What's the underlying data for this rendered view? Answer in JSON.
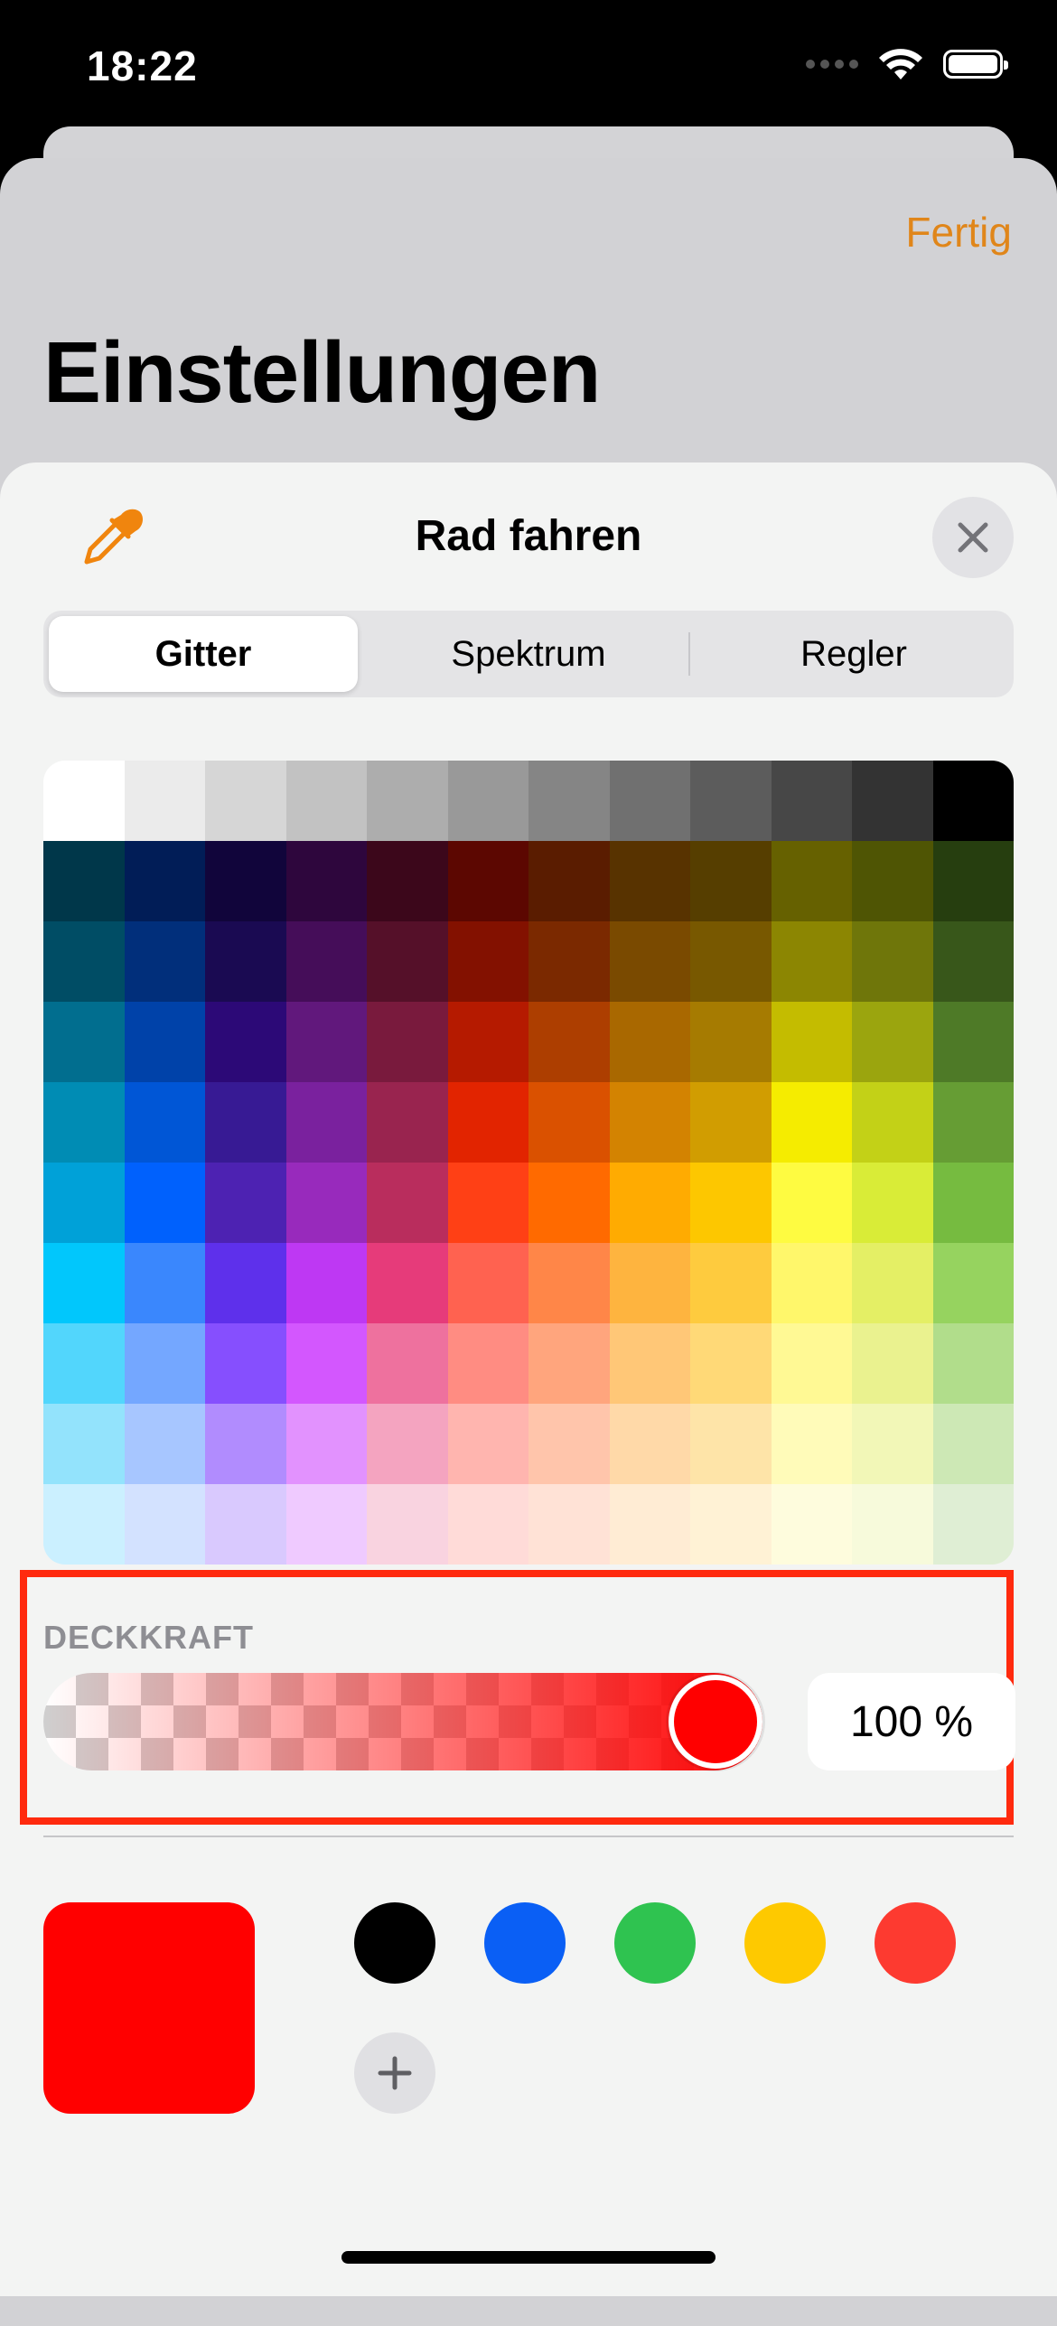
{
  "status_bar": {
    "time": "18:22"
  },
  "settings": {
    "done_label": "Fertig",
    "title": "Einstellungen"
  },
  "picker": {
    "title": "Rad fahren",
    "tabs": [
      {
        "label": "Gitter",
        "active": true
      },
      {
        "label": "Spektrum",
        "active": false
      },
      {
        "label": "Regler",
        "active": false
      }
    ],
    "opacity_label": "DECKKRAFT",
    "opacity_value": "100 %",
    "opacity_fraction": 1.0,
    "selected_color": "#ff0000",
    "presets": [
      {
        "name": "black",
        "color": "#000000"
      },
      {
        "name": "blue",
        "color": "#0a5ff5"
      },
      {
        "name": "green",
        "color": "#2fc350"
      },
      {
        "name": "yellow",
        "color": "#fec900"
      },
      {
        "name": "red",
        "color": "#fd3a30"
      }
    ],
    "grid_colors": [
      [
        "#ffffff",
        "#ebebeb",
        "#d6d6d6",
        "#c2c2c2",
        "#adadad",
        "#999999",
        "#858585",
        "#707070",
        "#5c5c5c",
        "#474747",
        "#333333",
        "#000000"
      ],
      [
        "#00374a",
        "#011d57",
        "#11053b",
        "#2e063d",
        "#3c071b",
        "#5c0701",
        "#5a1c00",
        "#583300",
        "#563e00",
        "#666100",
        "#4f5504",
        "#263e0f"
      ],
      [
        "#004d65",
        "#012f7b",
        "#1a0a52",
        "#450d59",
        "#551029",
        "#831100",
        "#7b2900",
        "#7a4a00",
        "#785800",
        "#8c8602",
        "#6f760a",
        "#38571a"
      ],
      [
        "#016e8f",
        "#0042a9",
        "#2c0977",
        "#61187c",
        "#791a3d",
        "#b51a00",
        "#ad3e00",
        "#a96800",
        "#a67b01",
        "#c4bc00",
        "#9ba50e",
        "#4e7a27"
      ],
      [
        "#008cb4",
        "#0056d6",
        "#371a94",
        "#7a219e",
        "#99244f",
        "#e22400",
        "#da5100",
        "#d38301",
        "#d19d01",
        "#f5ec00",
        "#c3d117",
        "#669d34"
      ],
      [
        "#00a1d8",
        "#0061fd",
        "#4d22b2",
        "#982abc",
        "#b92d5d",
        "#ff4015",
        "#ff6a00",
        "#ffab01",
        "#fdc700",
        "#fefb41",
        "#d9ec37",
        "#76bb40"
      ],
      [
        "#01c7fc",
        "#3a87fd",
        "#5e30eb",
        "#be38f3",
        "#e63b7a",
        "#ff6250",
        "#ff8648",
        "#feb43f",
        "#fecb3e",
        "#fff76b",
        "#e4ef65",
        "#96d35f"
      ],
      [
        "#52d6fc",
        "#74a7ff",
        "#864ffe",
        "#d357fe",
        "#ee719e",
        "#ff8c82",
        "#ffa57d",
        "#ffc777",
        "#ffd977",
        "#fff994",
        "#eaf28f",
        "#b1dd8b"
      ],
      [
        "#93e3fc",
        "#a7c6ff",
        "#b18cfe",
        "#e292fe",
        "#f4a4c0",
        "#ffb5af",
        "#ffc5ab",
        "#ffd9a8",
        "#fee4a8",
        "#fffbb9",
        "#f2f7b7",
        "#cde8b5"
      ],
      [
        "#cbf0ff",
        "#d3e2ff",
        "#d9c9fe",
        "#efcaff",
        "#f9d3e0",
        "#ffdbd8",
        "#ffe2d6",
        "#ffecd4",
        "#fff2d5",
        "#fefcdd",
        "#f7fadb",
        "#dfeed4"
      ]
    ]
  }
}
